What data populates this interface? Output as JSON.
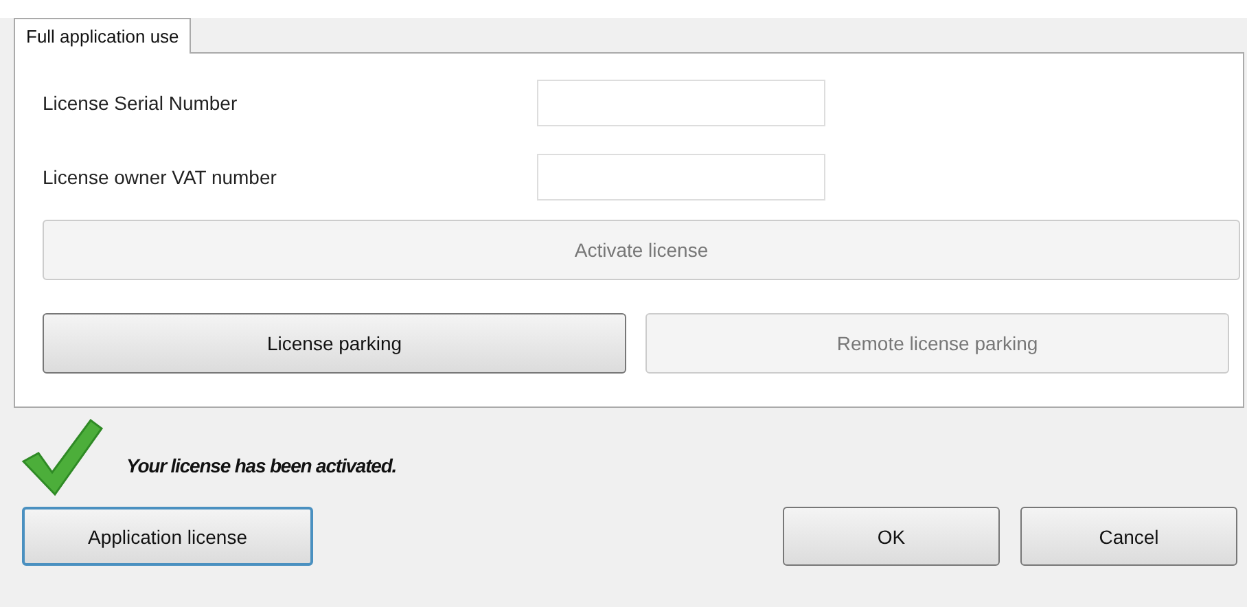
{
  "tabs": [
    {
      "label": "Full application use",
      "selected": true
    }
  ],
  "fields": [
    {
      "label": "License Serial Number"
    },
    {
      "label": "License owner VAT number"
    }
  ],
  "activate_button": {
    "label": "Activate license",
    "disabled": true
  },
  "parking_buttons": [
    {
      "label": "License parking",
      "disabled": false
    },
    {
      "label": "Remote license parking",
      "disabled": true
    }
  ],
  "status": {
    "message": "Your license has been activated.",
    "success": true
  },
  "footer_left_buttons": [
    {
      "label": "Application license",
      "focused": true
    }
  ],
  "footer_right_buttons": [
    {
      "label": "OK",
      "focused": false
    },
    {
      "label": "Cancel",
      "focused": false
    }
  ]
}
